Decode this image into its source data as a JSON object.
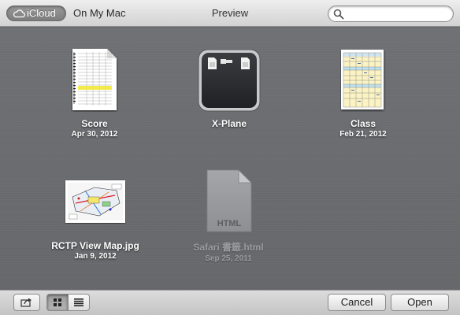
{
  "toolbar": {
    "source_icloud": "iCloud",
    "source_mac": "On My Mac",
    "title": "Preview",
    "search_value": "",
    "search_placeholder": ""
  },
  "documents": [
    {
      "name": "Score",
      "date": "Apr 30, 2012",
      "icon": "score-sheet-thumbnail"
    },
    {
      "name": "X-Plane",
      "date": "",
      "icon": "folder-thumbnail"
    },
    {
      "name": "Class",
      "date": "Feb 21, 2012",
      "icon": "class-timetable-thumbnail"
    },
    {
      "name": "RCTP View Map.jpg",
      "date": "Jan 9, 2012",
      "icon": "map-thumbnail"
    },
    {
      "name": "Safari 書籤.html",
      "date": "Sep 25, 2011",
      "icon": "html-document-icon",
      "badge": "HTML"
    }
  ],
  "bottom": {
    "cancel_label": "Cancel",
    "open_label": "Open"
  },
  "colors": {
    "browser_bg": "#6b6d70",
    "class_thumb_fill": "#fbf3c4",
    "class_thumb_accent": "#bfe2ee",
    "score_highlight": "#f3ea3a"
  }
}
